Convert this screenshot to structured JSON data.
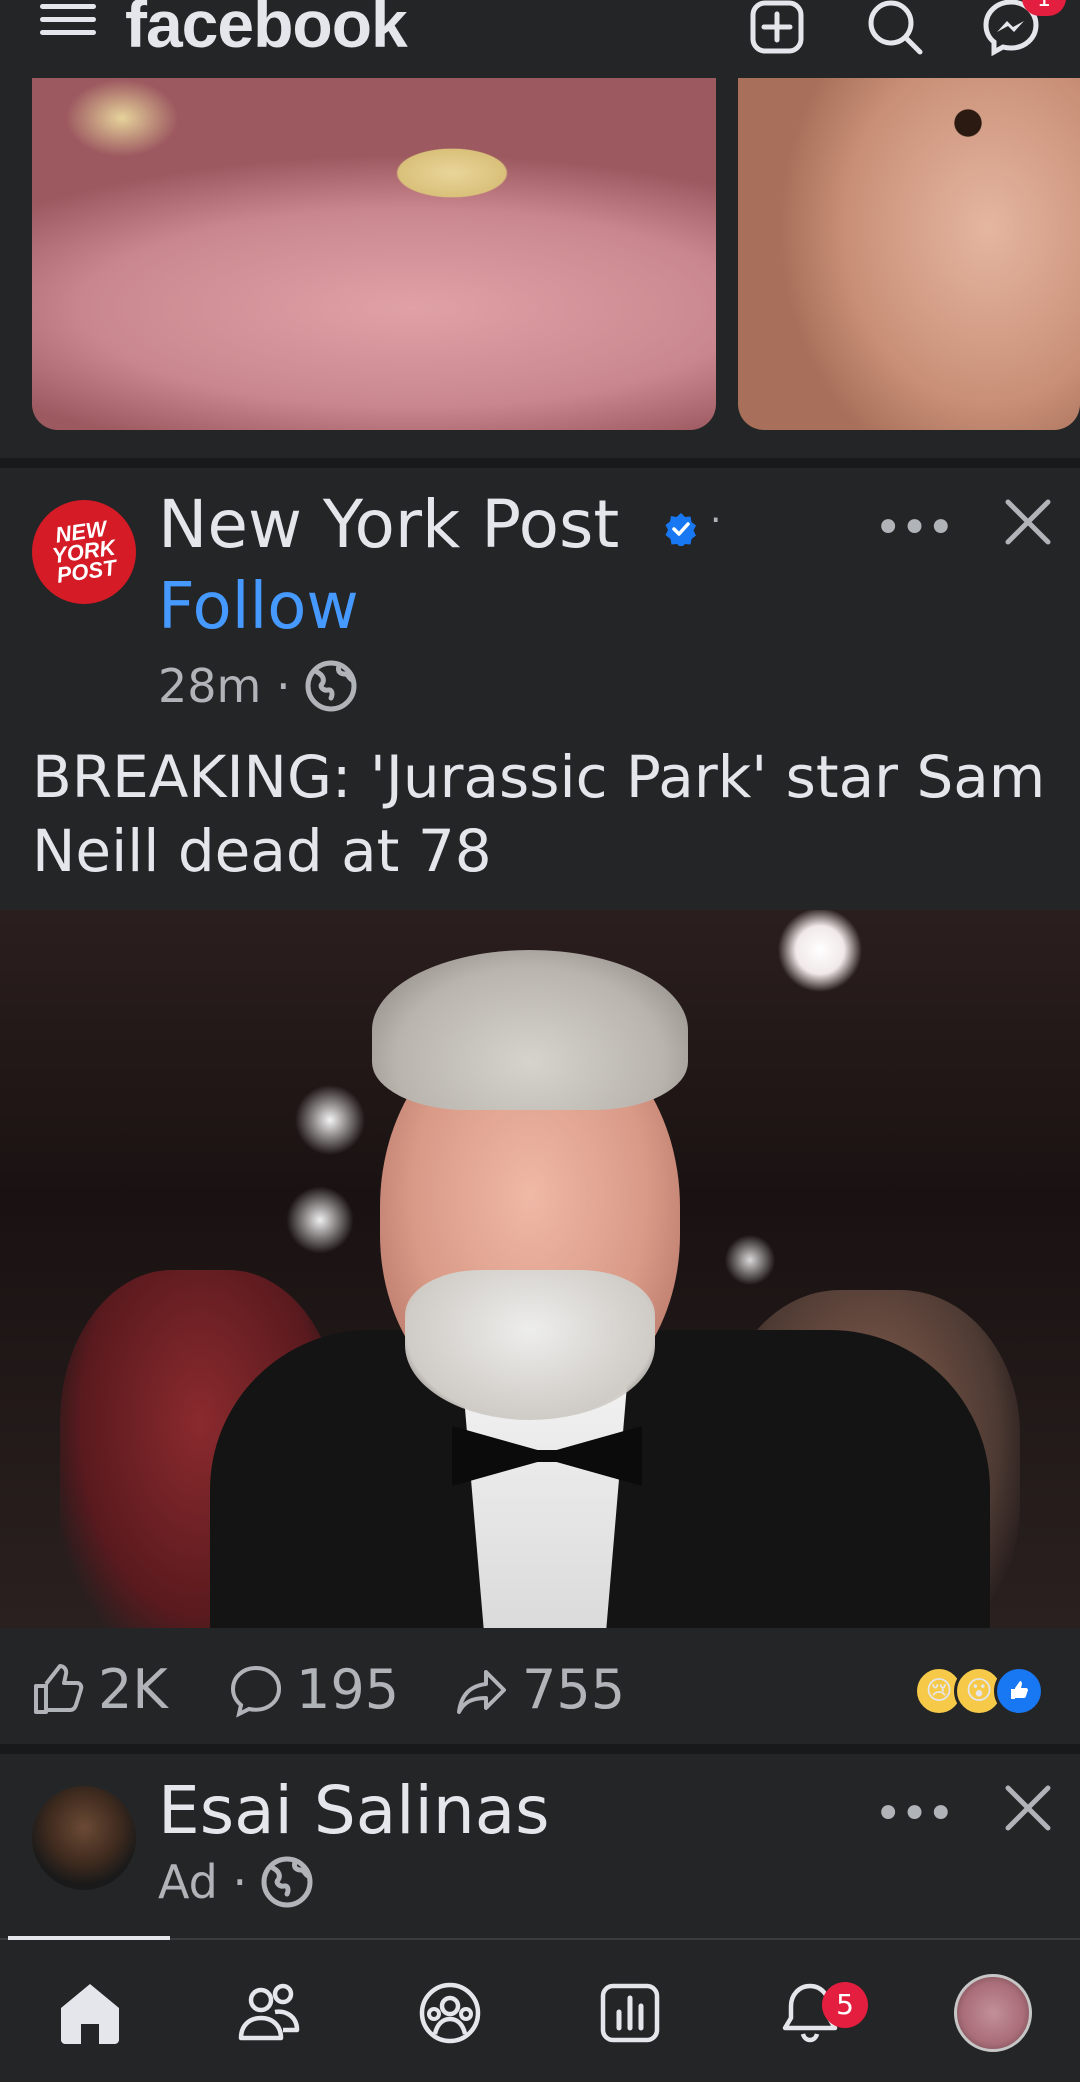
{
  "app": {
    "logo": "facebook"
  },
  "header": {
    "messenger_badge": "1"
  },
  "post": {
    "author": "New York Post",
    "avatar_text": "NEW\nYORK\nPOST",
    "separator": "·",
    "follow_label": "Follow",
    "time": "28m ·",
    "headline": "BREAKING: 'Jurassic Park' star Sam Neill dead at 78",
    "reactions": {
      "likes": "2K",
      "comments": "195",
      "shares": "755"
    },
    "more": "•••"
  },
  "next_post": {
    "author": "Esai Salinas",
    "meta": "Ad ·",
    "more": "•••"
  },
  "nav": {
    "notifications_badge": "5"
  },
  "colors": {
    "background": "#242526",
    "accent": "#4599ff",
    "badge": "#e41e3f"
  }
}
